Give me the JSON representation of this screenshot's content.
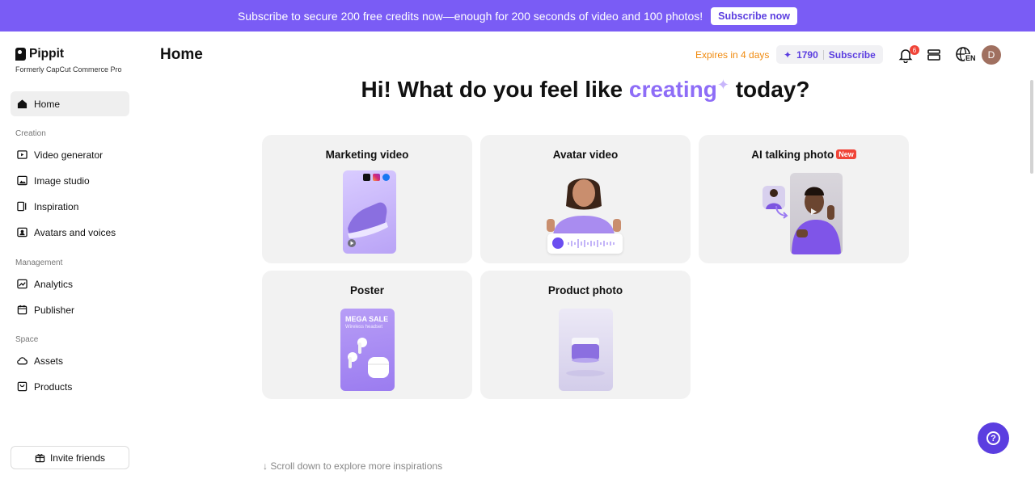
{
  "banner": {
    "text": "Subscribe to secure 200 free credits now—enough for 200 seconds of video and 100 photos!",
    "button": "Subscribe now"
  },
  "sidebar": {
    "logo": "Pippit",
    "subtitle": "Formerly CapCut Commerce Pro",
    "home": "Home",
    "sections": {
      "creation": "Creation",
      "management": "Management",
      "space": "Space"
    },
    "creation_items": [
      "Video generator",
      "Image studio",
      "Inspiration",
      "Avatars and voices"
    ],
    "management_items": [
      "Analytics",
      "Publisher"
    ],
    "space_items": [
      "Assets",
      "Products"
    ],
    "invite": "Invite friends"
  },
  "header": {
    "title": "Home",
    "expires": "Expires in 4 days",
    "credits": "1790",
    "subscribe": "Subscribe",
    "notification_count": "6",
    "language": "EN",
    "avatar_initial": "D"
  },
  "headline": {
    "before": "Hi! What do you feel like ",
    "highlight": "creating",
    "after": " today?"
  },
  "cards": {
    "marketing_video": "Marketing video",
    "avatar_video": "Avatar video",
    "ai_talking_photo": "AI talking photo",
    "new_badge": "New",
    "poster": "Poster",
    "product_photo": "Product photo"
  },
  "poster_thumb": {
    "title": "MEGA SALE",
    "subtitle": "Wireless headset"
  },
  "scroll_hint": "Scroll down to explore more inspirations",
  "colors": {
    "brand": "#7a5cf5",
    "accent": "#5b3ee0",
    "warning": "#f08a0e",
    "badge": "#f04438"
  }
}
